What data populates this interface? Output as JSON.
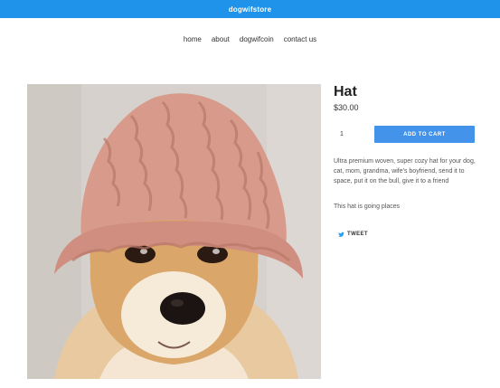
{
  "store": {
    "name": "dogwifstore",
    "brand_color": "#1e93e9"
  },
  "nav": {
    "items": [
      {
        "label": "home"
      },
      {
        "label": "about"
      },
      {
        "label": "dogwifcoin"
      },
      {
        "label": "contact us"
      }
    ]
  },
  "product": {
    "title": "Hat",
    "price": "$30.00",
    "quantity": "1",
    "add_to_cart_label": "ADD TO CART",
    "button_color": "#4393ea",
    "description": "Ultra premium woven, super cozy hat for your dog, cat, mom, grandma, wife's boyfriend, send it to space, put it on the bull, give it to a friend",
    "tagline": "This hat is going places",
    "image_subject": "shiba-inu-dog-wearing-pink-knit-hat"
  },
  "share": {
    "tweet_label": "TWEET",
    "icon": "twitter-bird-icon"
  }
}
